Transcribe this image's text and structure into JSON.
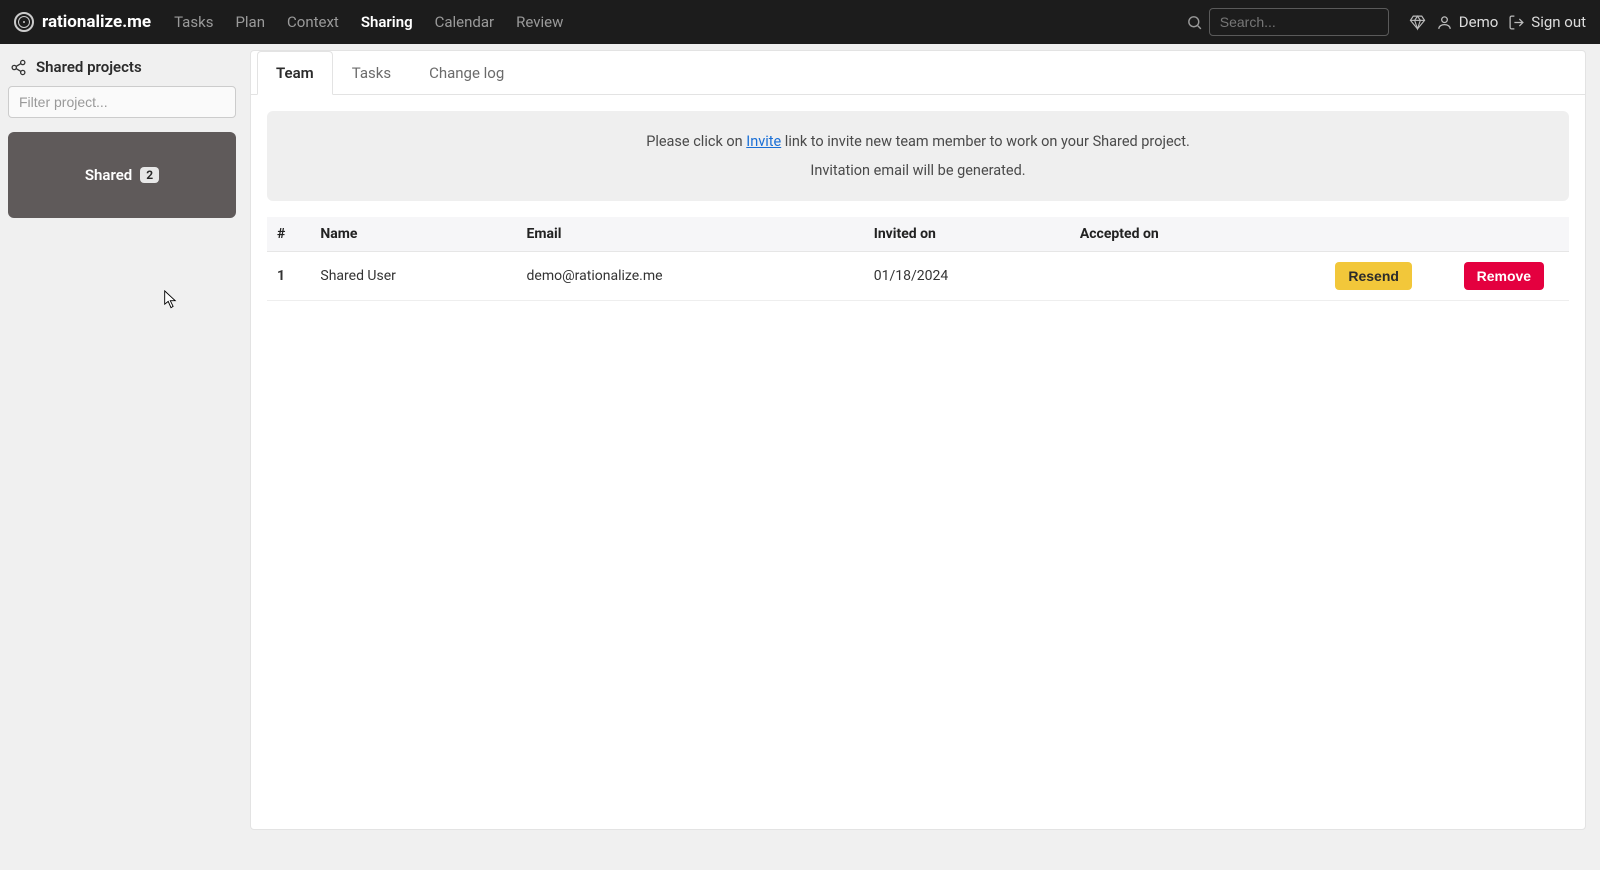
{
  "brand": "rationalize.me",
  "nav": {
    "items": [
      "Tasks",
      "Plan",
      "Context",
      "Sharing",
      "Calendar",
      "Review"
    ],
    "active_index": 3,
    "search_placeholder": "Search...",
    "user_label": "Demo",
    "signout_label": "Sign out"
  },
  "sidebar": {
    "title": "Shared projects",
    "filter_placeholder": "Filter project...",
    "project": {
      "name": "Shared",
      "badge": "2"
    }
  },
  "tabs": {
    "items": [
      "Team",
      "Tasks",
      "Change log"
    ],
    "active_index": 0
  },
  "notice": {
    "prefix": "Please click on ",
    "link": "Invite",
    "suffix": " link to invite new team member to work on your Shared project.",
    "line2": "Invitation email will be generated."
  },
  "table": {
    "headers": {
      "idx": "#",
      "name": "Name",
      "email": "Email",
      "invited": "Invited on",
      "accepted": "Accepted on"
    },
    "rows": [
      {
        "idx": "1",
        "name": "Shared User",
        "email": "demo@rationalize.me",
        "invited": "01/18/2024",
        "accepted": ""
      }
    ],
    "resend_label": "Resend",
    "remove_label": "Remove"
  }
}
